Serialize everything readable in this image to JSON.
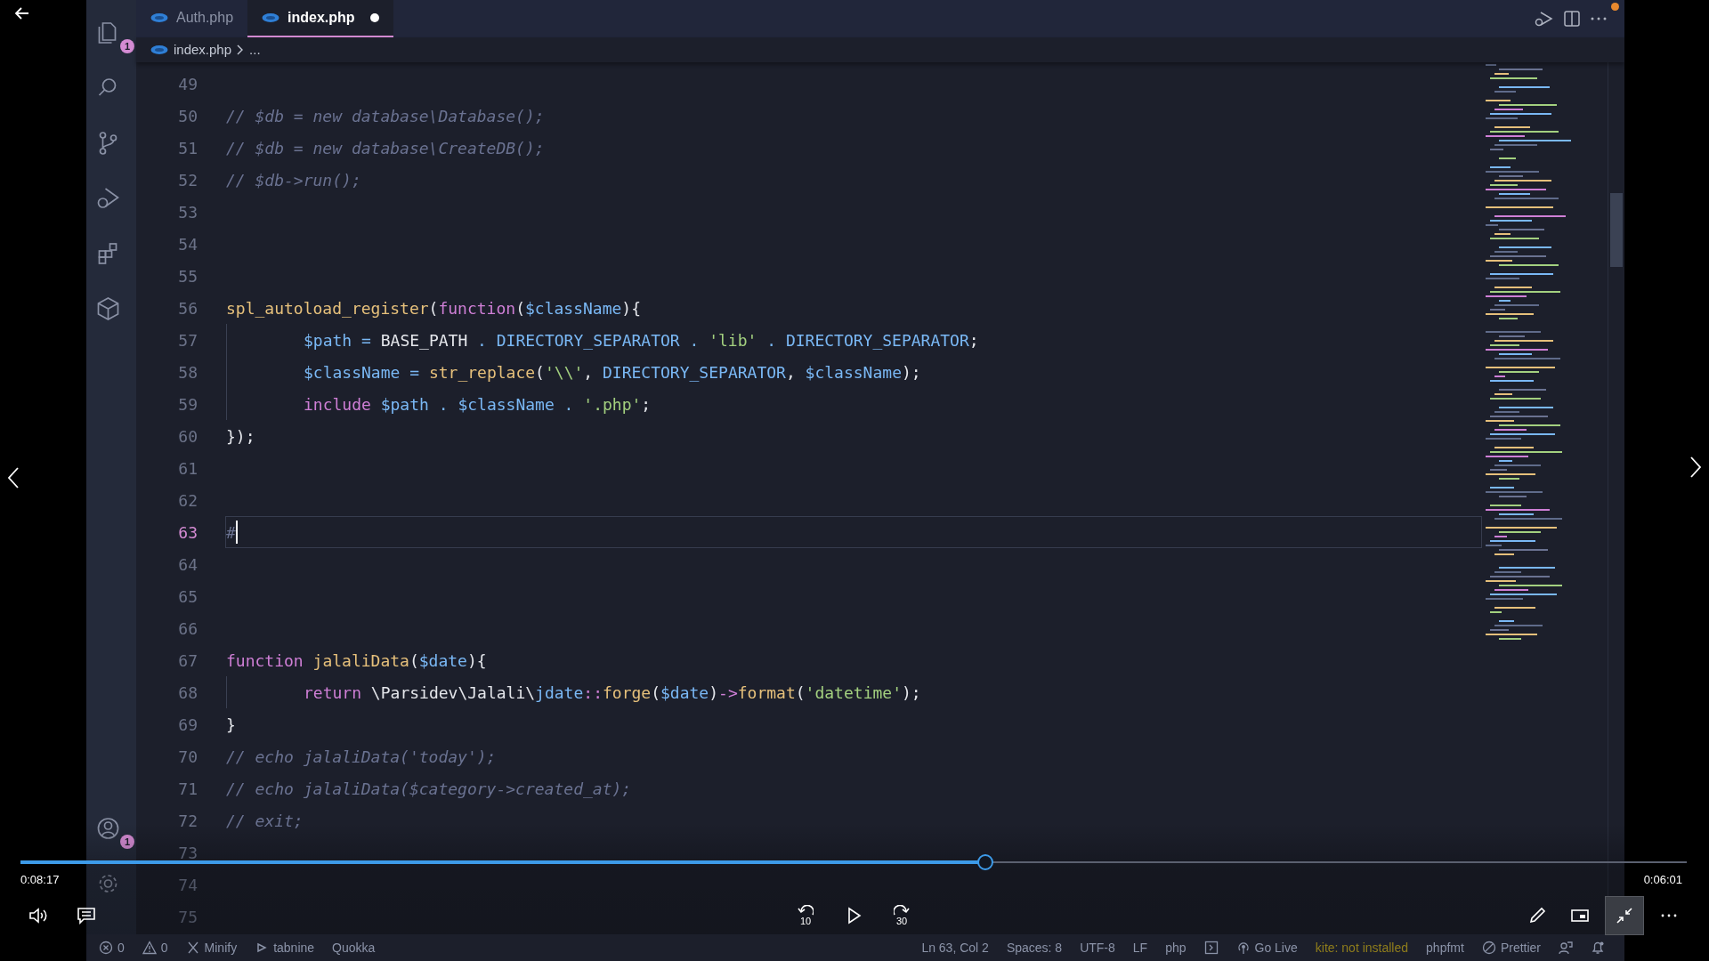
{
  "activity_bar": {
    "top": [
      {
        "kind": "files",
        "badge": "1"
      },
      {
        "kind": "search"
      },
      {
        "kind": "branch"
      },
      {
        "kind": "debug"
      },
      {
        "kind": "extensions"
      },
      {
        "kind": "cube"
      }
    ],
    "bottom": [
      {
        "kind": "account",
        "badge": "1"
      },
      {
        "kind": "settings"
      }
    ]
  },
  "tabs": [
    {
      "label": "Auth.php",
      "selected": false,
      "modified": false
    },
    {
      "label": "index.php",
      "selected": true,
      "modified": true
    }
  ],
  "breadcrumb": [
    "index.php",
    "..."
  ],
  "editor": {
    "lines": [
      {
        "number": "49",
        "indented": false,
        "current": false
      },
      {
        "number": "50",
        "indented": false,
        "current": false,
        "tokens": [
          {
            "kind": "comment",
            "text": "// $db = new database\\Database();"
          }
        ]
      },
      {
        "number": "51",
        "indented": false,
        "current": false,
        "tokens": [
          {
            "kind": "comment",
            "text": "// $db = new database\\CreateDB();"
          }
        ]
      },
      {
        "number": "52",
        "indented": false,
        "current": false,
        "tokens": [
          {
            "kind": "comment",
            "text": "// $db->run();"
          }
        ]
      },
      {
        "number": "53",
        "indented": false,
        "current": false
      },
      {
        "number": "54",
        "indented": false,
        "current": false
      },
      {
        "number": "55",
        "indented": false,
        "current": false
      },
      {
        "number": "56",
        "indented": false,
        "current": false,
        "tokens": [
          {
            "kind": "fn",
            "text": "spl_autoload_register"
          },
          {
            "kind": "plain",
            "text": "("
          },
          {
            "kind": "kw",
            "text": "function"
          },
          {
            "kind": "plain",
            "text": "("
          },
          {
            "kind": "var",
            "text": "$className"
          },
          {
            "kind": "plain",
            "text": "){"
          }
        ]
      },
      {
        "number": "57",
        "indented": true,
        "current": false,
        "tokens": [
          {
            "kind": "var",
            "text": "$path"
          },
          {
            "kind": "op",
            "text": " = "
          },
          {
            "kind": "plain",
            "text": "BASE_PATH"
          },
          {
            "kind": "op",
            "text": " . "
          },
          {
            "kind": "const",
            "text": "DIRECTORY_SEPARATOR"
          },
          {
            "kind": "op",
            "text": " . "
          },
          {
            "kind": "str",
            "text": "'lib'"
          },
          {
            "kind": "op",
            "text": " . "
          },
          {
            "kind": "const",
            "text": "DIRECTORY_SEPARATOR"
          },
          {
            "kind": "plain",
            "text": ";"
          }
        ]
      },
      {
        "number": "58",
        "indented": true,
        "current": false,
        "tokens": [
          {
            "kind": "var",
            "text": "$className"
          },
          {
            "kind": "op",
            "text": " = "
          },
          {
            "kind": "fn",
            "text": "str_replace"
          },
          {
            "kind": "plain",
            "text": "("
          },
          {
            "kind": "str",
            "text": "'\\\\'"
          },
          {
            "kind": "plain",
            "text": ", "
          },
          {
            "kind": "const",
            "text": "DIRECTORY_SEPARATOR"
          },
          {
            "kind": "plain",
            "text": ", "
          },
          {
            "kind": "var",
            "text": "$className"
          },
          {
            "kind": "plain",
            "text": ");"
          }
        ]
      },
      {
        "number": "59",
        "indented": true,
        "current": false,
        "tokens": [
          {
            "kind": "kw",
            "text": "include"
          },
          {
            "kind": "var",
            "text": " $path"
          },
          {
            "kind": "op",
            "text": " . "
          },
          {
            "kind": "var",
            "text": "$className"
          },
          {
            "kind": "op",
            "text": " . "
          },
          {
            "kind": "str",
            "text": "'.php'"
          },
          {
            "kind": "plain",
            "text": ";"
          }
        ]
      },
      {
        "number": "60",
        "indented": false,
        "current": false,
        "tokens": [
          {
            "kind": "plain",
            "text": "});"
          }
        ]
      },
      {
        "number": "61",
        "indented": false,
        "current": false
      },
      {
        "number": "62",
        "indented": false,
        "current": false
      },
      {
        "number": "63",
        "indented": false,
        "current": true,
        "tokens": [
          {
            "kind": "comment",
            "text": "#"
          }
        ]
      },
      {
        "number": "64",
        "indented": false,
        "current": false
      },
      {
        "number": "65",
        "indented": false,
        "current": false
      },
      {
        "number": "66",
        "indented": false,
        "current": false
      },
      {
        "number": "67",
        "indented": false,
        "current": false,
        "tokens": [
          {
            "kind": "kw",
            "text": "function"
          },
          {
            "kind": "fn",
            "text": " jalaliData"
          },
          {
            "kind": "plain",
            "text": "("
          },
          {
            "kind": "var",
            "text": "$date"
          },
          {
            "kind": "plain",
            "text": "){"
          }
        ]
      },
      {
        "number": "68",
        "indented": true,
        "current": false,
        "tokens": [
          {
            "kind": "kw",
            "text": "return"
          },
          {
            "kind": "plain",
            "text": " \\Parsidev\\Jalali\\"
          },
          {
            "kind": "const",
            "text": "jdate"
          },
          {
            "kind": "kw",
            "text": "::"
          },
          {
            "kind": "fn",
            "text": "forge"
          },
          {
            "kind": "plain",
            "text": "("
          },
          {
            "kind": "var",
            "text": "$date"
          },
          {
            "kind": "plain",
            "text": ")"
          },
          {
            "kind": "kw",
            "text": "->"
          },
          {
            "kind": "fn",
            "text": "format"
          },
          {
            "kind": "plain",
            "text": "("
          },
          {
            "kind": "str",
            "text": "'datetime'"
          },
          {
            "kind": "plain",
            "text": ");"
          }
        ]
      },
      {
        "number": "69",
        "indented": false,
        "current": false,
        "tokens": [
          {
            "kind": "plain",
            "text": "}"
          }
        ]
      },
      {
        "number": "70",
        "indented": false,
        "current": false,
        "tokens": [
          {
            "kind": "comment",
            "text": "// echo jalaliData('today');"
          }
        ]
      },
      {
        "number": "71",
        "indented": false,
        "current": false,
        "tokens": [
          {
            "kind": "comment",
            "text": "// echo jalaliData($category->created_at);"
          }
        ]
      },
      {
        "number": "72",
        "indented": false,
        "current": false,
        "tokens": [
          {
            "kind": "comment",
            "text": "// exit;"
          }
        ]
      },
      {
        "number": "73",
        "indented": false,
        "current": false
      },
      {
        "number": "74",
        "indented": false,
        "current": false
      },
      {
        "number": "75",
        "indented": false,
        "current": false
      }
    ]
  },
  "status_bar": {
    "left": [
      {
        "kind": "errors",
        "text": "0"
      },
      {
        "kind": "warnings",
        "text": "0"
      },
      {
        "kind": "minify",
        "text": "Minify"
      },
      {
        "kind": "tabnine",
        "text": "tabnine"
      },
      {
        "kind": "text",
        "text": "Quokka"
      }
    ],
    "right": [
      {
        "kind": "text",
        "text": "Ln 63, Col 2"
      },
      {
        "kind": "text",
        "text": "Spaces: 8"
      },
      {
        "kind": "text",
        "text": "UTF-8"
      },
      {
        "kind": "text",
        "text": "LF"
      },
      {
        "kind": "text",
        "text": "php"
      },
      {
        "kind": "terminal"
      },
      {
        "kind": "live",
        "text": "Go Live"
      },
      {
        "kind": "warning",
        "text": "kite: not installed"
      },
      {
        "kind": "text",
        "text": "phpfmt"
      },
      {
        "kind": "prettier",
        "text": "Prettier"
      },
      {
        "kind": "feedback"
      },
      {
        "kind": "bell"
      }
    ]
  },
  "video_player": {
    "elapsed": "0:08:17",
    "remaining": "0:06:01",
    "level": 0.579,
    "left_controls": [
      {
        "kind": "volume",
        "highlighted": false
      },
      {
        "kind": "captions",
        "highlighted": false
      }
    ],
    "center_controls": [
      {
        "kind": "rewind",
        "label": "10",
        "highlighted": false
      },
      {
        "kind": "play",
        "highlighted": false
      },
      {
        "kind": "forward",
        "label": "30",
        "highlighted": false
      }
    ],
    "right_controls": [
      {
        "kind": "pen",
        "highlighted": false
      },
      {
        "kind": "pip",
        "highlighted": false
      },
      {
        "kind": "exit-fullscreen",
        "highlighted": true
      },
      {
        "kind": "more",
        "highlighted": false
      }
    ]
  }
}
